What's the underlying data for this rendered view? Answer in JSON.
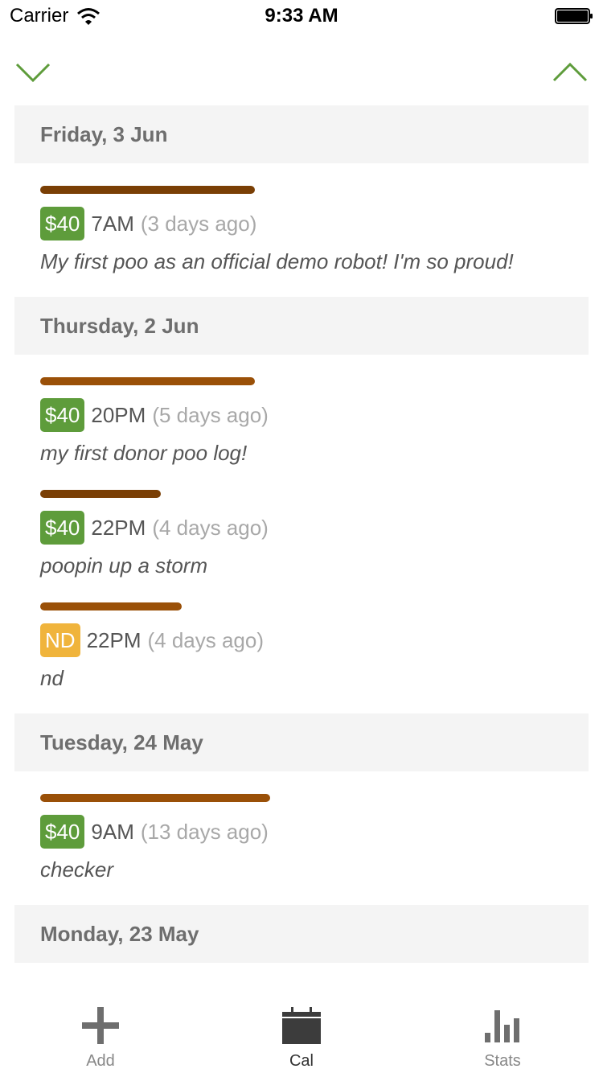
{
  "status_bar": {
    "carrier": "Carrier",
    "time": "9:33 AM"
  },
  "nav": {
    "down_icon": "chevron-down-icon",
    "up_icon": "chevron-up-icon",
    "accent": "#5e9c3b"
  },
  "sections": [
    {
      "date": "Friday, 3 Jun",
      "entries": [
        {
          "bar_percent": 41,
          "bar_color": "#7a3f05",
          "badge": "$40",
          "badge_color": "green",
          "time": "7AM",
          "ago": "(3 days ago)",
          "note": "My first poo as an official demo robot! I'm so proud!"
        }
      ]
    },
    {
      "date": "Thursday, 2 Jun",
      "entries": [
        {
          "bar_percent": 41,
          "bar_color": "#9a5008",
          "badge": "$40",
          "badge_color": "green",
          "time": "20PM",
          "ago": "(5 days ago)",
          "note": "my first donor poo log!"
        },
        {
          "bar_percent": 23,
          "bar_color": "#7a3f05",
          "badge": "$40",
          "badge_color": "green",
          "time": "22PM",
          "ago": "(4 days ago)",
          "note": "poopin up a storm"
        },
        {
          "bar_percent": 27,
          "bar_color": "#9a5008",
          "badge": "ND",
          "badge_color": "yellow",
          "time": "22PM",
          "ago": "(4 days ago)",
          "note": "nd"
        }
      ]
    },
    {
      "date": "Tuesday, 24 May",
      "entries": [
        {
          "bar_percent": 44,
          "bar_color": "#9a5008",
          "badge": "$40",
          "badge_color": "green",
          "time": "9AM",
          "ago": "(13 days ago)",
          "note": "checker"
        }
      ]
    },
    {
      "date": "Monday, 23 May",
      "entries": []
    }
  ],
  "tabs": [
    {
      "label": "Add",
      "icon": "plus-icon",
      "active": false
    },
    {
      "label": "Cal",
      "icon": "calendar-icon",
      "active": true
    },
    {
      "label": "Stats",
      "icon": "bar-chart-icon",
      "active": false
    }
  ]
}
